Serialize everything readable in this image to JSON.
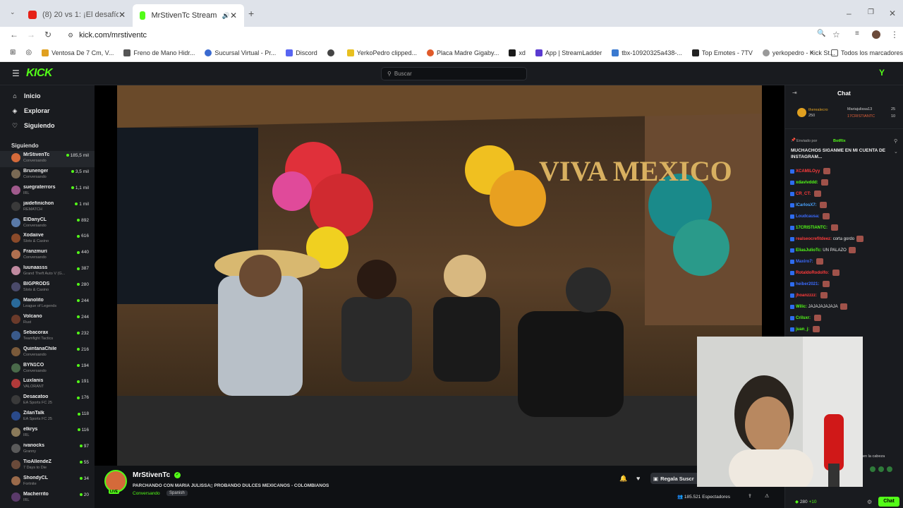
{
  "browser": {
    "tabs": [
      {
        "label": "(8) 20 vs 1: ¡El desafío definiti"
      },
      {
        "label": "MrStivenTc Stream - Watch"
      }
    ],
    "url": "kick.com/mrstiventc",
    "bookmarks": [
      "Ventosa De 7 Cm, V...",
      "Freno de Mano Hidr...",
      "Sucursal Virtual - Pr...",
      "Discord",
      "YerkoPedro clipped...",
      "Placa Madre Gigaby...",
      "xd",
      "App | StreamLadder",
      "tbx-10920325a438-...",
      "Top Emotes - 7TV",
      "yerkopedro - Kick St..."
    ],
    "all_bookmarks": "Todos los marcadores"
  },
  "kick": {
    "logo": "KICK",
    "search_placeholder": "Buscar",
    "nav": [
      {
        "label": "Inicio",
        "icon": "home-icon"
      },
      {
        "label": "Explorar",
        "icon": "compass-icon"
      },
      {
        "label": "Siguiendo",
        "icon": "heart-icon"
      }
    ],
    "following_header": "Siguiendo",
    "channels": [
      {
        "name": "MrStivenTc",
        "category": "Conversando",
        "viewers": "185,5 mil",
        "color": "#d46a3a"
      },
      {
        "name": "Brunenger",
        "category": "Conversando",
        "viewers": "3,5 mil",
        "color": "#7a6a55"
      },
      {
        "name": "suegraterrors",
        "category": "IRL",
        "viewers": "1,1 mil",
        "color": "#a05a8c"
      },
      {
        "name": "jaidefinichon",
        "category": "REMATCH",
        "viewers": "1 mil",
        "color": "#3a3a3a"
      },
      {
        "name": "ElDanyCL",
        "category": "Conversando",
        "viewers": "892",
        "color": "#5a7aa8"
      },
      {
        "name": "Xodaiive",
        "category": "Slots & Casino",
        "viewers": "616",
        "color": "#8a4a2a"
      },
      {
        "name": "Franzmuri",
        "category": "Conversando",
        "viewers": "440",
        "color": "#b07050"
      },
      {
        "name": "luunaasss",
        "category": "Grand Theft Auto V (G...",
        "viewers": "387",
        "color": "#c08aa0"
      },
      {
        "name": "BIGPRODS",
        "category": "Slots & Casino",
        "viewers": "280",
        "color": "#4a4a6a"
      },
      {
        "name": "Manolito",
        "category": "League of Legends",
        "viewers": "244",
        "color": "#2a6a9a"
      },
      {
        "name": "Volcano",
        "category": "Rust",
        "viewers": "244",
        "color": "#6a3a2a"
      },
      {
        "name": "Sebacorax",
        "category": "Teamfight Tactics",
        "viewers": "232",
        "color": "#3a5a8a"
      },
      {
        "name": "QuintanaChile",
        "category": "Conversando",
        "viewers": "216",
        "color": "#7a5a3a"
      },
      {
        "name": "BYN1CO",
        "category": "Conversando",
        "viewers": "194",
        "color": "#4a6a4a"
      },
      {
        "name": "Luxlanis",
        "category": "VALORANT",
        "viewers": "191",
        "color": "#b03a3a"
      },
      {
        "name": "Desacatoo",
        "category": "EA Sports FC 25",
        "viewers": "176",
        "color": "#3a3a3a"
      },
      {
        "name": "ZilanTalk",
        "category": "EA Sports FC 25",
        "viewers": "118",
        "color": "#2a4a8a"
      },
      {
        "name": "elkrys",
        "category": "IRL",
        "viewers": "116",
        "color": "#8a7a5a"
      },
      {
        "name": "ivanocks",
        "category": "Granny",
        "viewers": "97",
        "color": "#5a5a5a"
      },
      {
        "name": "TioAllendeZ",
        "category": "7 Days to Die",
        "viewers": "55",
        "color": "#6a4a3a"
      },
      {
        "name": "ShondyCL",
        "category": "Fortnite",
        "viewers": "34",
        "color": "#9a6a4a"
      },
      {
        "name": "Macherrito",
        "category": "IRL",
        "viewers": "20",
        "color": "#5a3a6a"
      }
    ],
    "stream": {
      "channel": "MrStivenTc",
      "title": "PARCHANDO CON MARIA JULISSA▯ PROBANDO DULCES MEXICANOS - COLOMBIANOS",
      "category": "Conversando",
      "language": "Spanish",
      "subscribe_label": "Regala Suscr",
      "viewers": "185.521 Espectadores",
      "live_badge": "LIVE",
      "banner_text": "VIVA MEXICO"
    },
    "chat": {
      "header": "Chat",
      "pinned_user": "therealecro",
      "pinned_amount": "250",
      "top_users": [
        {
          "name": "Mariajulissa13",
          "count": "25"
        },
        {
          "name": "17CRISTIANTC",
          "count": "10"
        }
      ],
      "sent_by_label": "Enviado por",
      "sent_by_user": "BotRix",
      "pinned_message": "MUCHACHOS SIGANME EN MI CUENTA DE INSTAGRAM...",
      "messages": [
        {
          "user": "XCAMILOyy",
          "text": "",
          "color": "#ff3b3b"
        },
        {
          "user": "xdavivddd:",
          "text": "",
          "color": "#53fc18"
        },
        {
          "user": "CR_CT:",
          "text": "",
          "color": "#ff3b3b"
        },
        {
          "user": "ICarlosX7:",
          "text": "",
          "color": "#4aa3ff"
        },
        {
          "user": "Loudcausa:",
          "text": "",
          "color": "#3b6bff"
        },
        {
          "user": "17CRISTIANTC:",
          "text": "",
          "color": "#53fc18"
        },
        {
          "user": "realseocrefitdeez:",
          "text": "corta gordo",
          "color": "#ff3b3b"
        },
        {
          "user": "EliasJulioTc:",
          "text": "UN PALAZO",
          "color": "#53fc18"
        },
        {
          "user": "Maxiro7:",
          "text": "",
          "color": "#3b6bff"
        },
        {
          "user": "RotaldoRodolfo:",
          "text": "",
          "color": "#ff3b3b"
        },
        {
          "user": "heiber2021:",
          "text": "",
          "color": "#3b6bff"
        },
        {
          "user": "jhoanzzzz:",
          "text": "",
          "color": "#ff3b3b"
        },
        {
          "user": "Wilic:",
          "text": "JAJAJAJAJAJA",
          "color": "#53fc18"
        },
        {
          "user": "Crilsxr:",
          "text": "",
          "color": "#53fc18"
        },
        {
          "user": "juan_j:",
          "text": "",
          "color": "#53fc18"
        }
      ],
      "fragment": "en la cabeza",
      "points": "280",
      "points_extra": "+10",
      "chat_button": "Chat"
    }
  }
}
